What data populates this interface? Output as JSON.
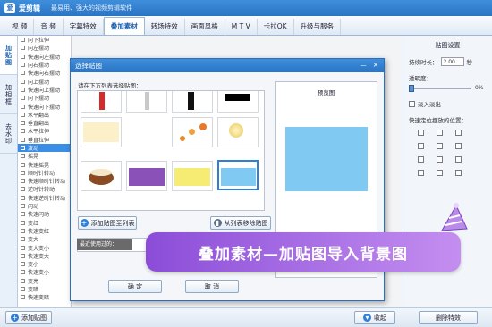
{
  "app": {
    "name": "爱剪辑",
    "slogan": "最易用、强大的视频剪辑软件",
    "logo_text": "爱"
  },
  "tabs": [
    "视 频",
    "音 频",
    "字幕特效",
    "叠加素材",
    "转场特效",
    "画面风格",
    "M T V",
    "卡拉OK",
    "升级与服务"
  ],
  "active_tab": 3,
  "side_tabs": [
    "加贴图",
    "加相框",
    "去水印"
  ],
  "effects": [
    "向下拉伸",
    "向左摆动",
    "快速向左摆动",
    "向右摆动",
    "快速向右摆动",
    "向上摆动",
    "快速向上摆动",
    "向下摆动",
    "快速向下摆动",
    "水平翻出",
    "垂直翻出",
    "水平拉伸",
    "垂直拉伸",
    "波动",
    "摇晃",
    "快速摇晃",
    "顺时针转动",
    "快速顺时针转动",
    "逆时针转动",
    "快速逆时针转动",
    "闪动",
    "快速闪动",
    "变红",
    "快速变红",
    "变大",
    "变大变小",
    "快速变大",
    "变小",
    "快速变小",
    "变亮",
    "变暗",
    "快速变暗"
  ],
  "selected_effect": 13,
  "right_panel": {
    "title": "贴图设置",
    "duration_label": "持续时长：",
    "duration_value": "2.00",
    "duration_unit": "秒",
    "opacity_label": "透明度：",
    "opacity_value": "0%",
    "opacity_fraction": 0,
    "fade_label": "淡入淡出",
    "position_label": "快速定位摆放的位置：",
    "effects_button": "删除特效"
  },
  "bottom": {
    "add_sticker": "添加贴图",
    "collapse": "收起"
  },
  "dialog": {
    "title": "选择贴图",
    "minimize": "—",
    "close": "×",
    "prompt": "请在下方列表选择贴图：",
    "preview_label": "预览图",
    "add_to_list": "添加贴图至列表",
    "delete_from_list": "从列表移除贴图",
    "recent_label": "最近使用过的：",
    "ok": "确 定",
    "cancel": "取 消"
  },
  "thumb_colors": {
    "purple": "#8a52b8",
    "yellow": "#f6ec74",
    "light_blue": "#80c9f2",
    "cream": "#fbf0c8"
  },
  "preview_color": "#80c9f2",
  "banner": {
    "text": "叠加素材—加贴图导入背景图"
  }
}
